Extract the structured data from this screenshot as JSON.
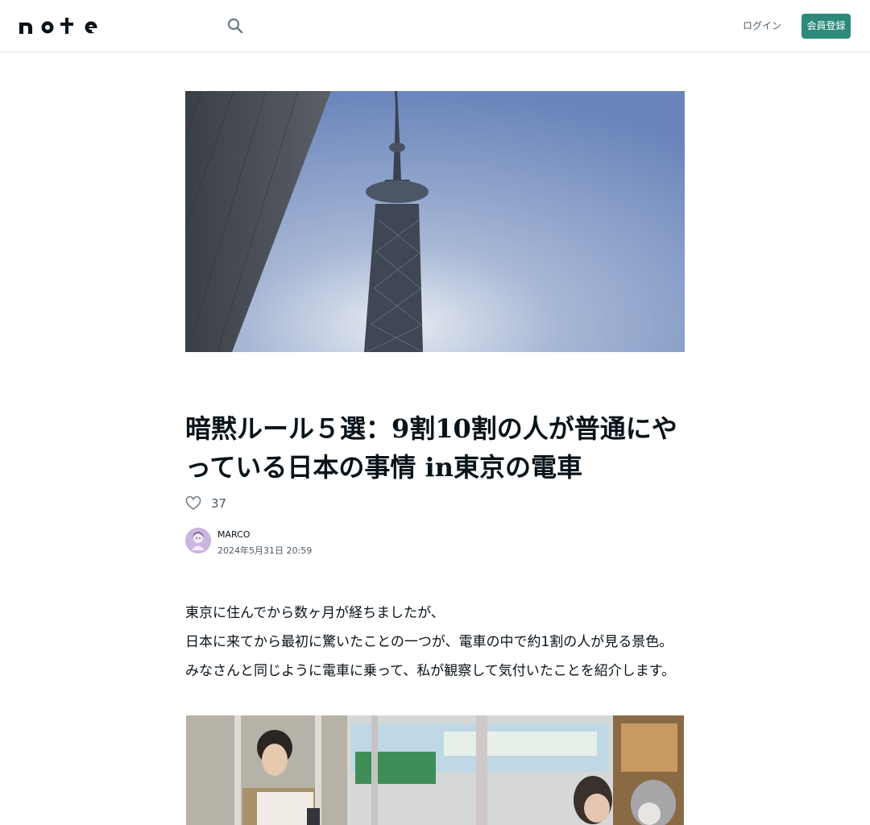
{
  "header": {
    "logo_text": "note",
    "search_icon": "search-icon",
    "login_label": "ログイン",
    "signup_label": "会員登録",
    "accent_color": "#2d8a7a"
  },
  "article": {
    "title": "暗黙ルール５選：9割10割の人が普通にやっている日本の事情 in東京の電車",
    "like_icon": "heart-outline-icon",
    "like_count": "37",
    "author_name": "MARCO",
    "published": "2024年5月31日 20:59",
    "paragraphs": [
      "東京に住んでから数ヶ月が経ちましたが、",
      "日本に来てから最初に驚いたことの一つが、電車の中で約1割の人が見る景色。",
      "みなさんと同じように電車に乗って、私が観察して気付いたことを紹介します。"
    ]
  }
}
